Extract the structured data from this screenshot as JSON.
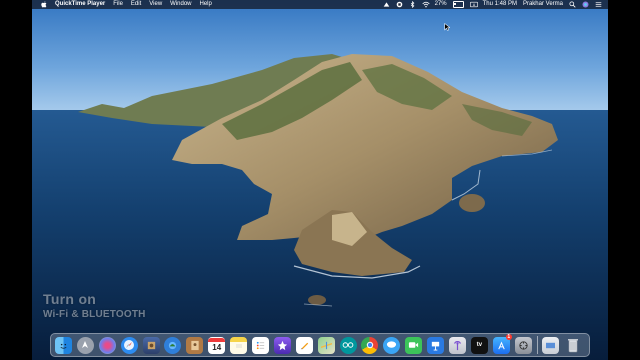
{
  "menubar": {
    "app_name": "QuickTime Player",
    "menus": [
      "File",
      "Edit",
      "View",
      "Window",
      "Help"
    ],
    "battery": "27%",
    "clock": "Thu 1:48 PM",
    "user": "Prakhar Verma"
  },
  "caption": {
    "line1": "Turn on",
    "line2": "Wi-Fi & BLUETOOTH"
  },
  "dock": {
    "calendar_day": "14",
    "badge_appstore": "1",
    "tv_label": "tv"
  },
  "colors": {
    "sky_top": "#2f74c2",
    "sky_bottom": "#9cc3e8",
    "ocean_top": "#1d4f86",
    "ocean_bottom": "#082447",
    "rock": "#b4a17c",
    "vegetation": "#556b3a"
  }
}
